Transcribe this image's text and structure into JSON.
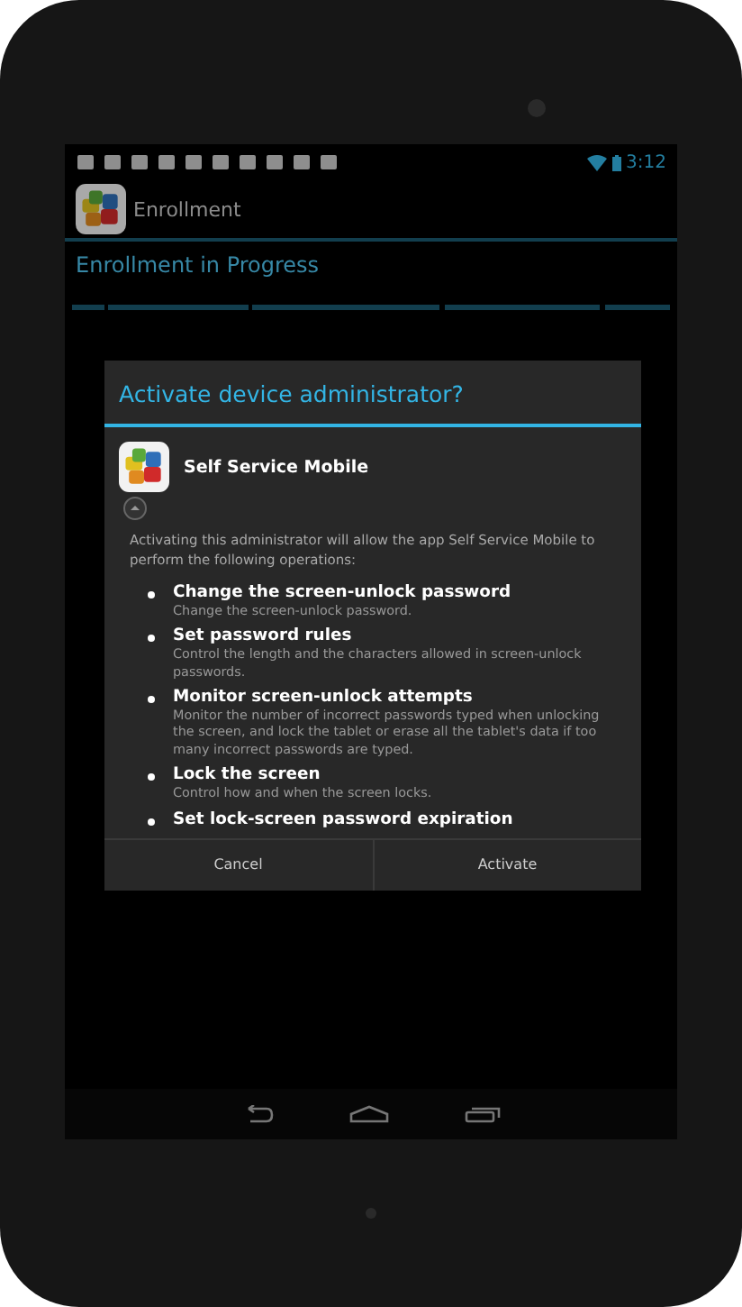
{
  "status_bar": {
    "time": "3:12"
  },
  "action_bar": {
    "title": "Enrollment"
  },
  "page": {
    "heading": "Enrollment in Progress"
  },
  "dialog": {
    "title": "Activate device administrator?",
    "app_name": "Self Service Mobile",
    "description": "Activating this administrator will allow the app Self Service Mobile to perform the following operations:",
    "permissions": [
      {
        "title": "Change the screen-unlock password",
        "detail": "Change the screen-unlock password."
      },
      {
        "title": "Set password rules",
        "detail": "Control the length and the characters allowed in screen-unlock passwords."
      },
      {
        "title": "Monitor screen-unlock attempts",
        "detail": "Monitor the number of incorrect passwords typed when unlocking the screen, and lock the tablet or erase all the tablet's data if too many incorrect passwords are typed."
      },
      {
        "title": "Lock the screen",
        "detail": "Control how and when the screen locks."
      },
      {
        "title": "Set lock-screen password expiration"
      }
    ],
    "buttons": [
      "Cancel",
      "Activate"
    ]
  }
}
